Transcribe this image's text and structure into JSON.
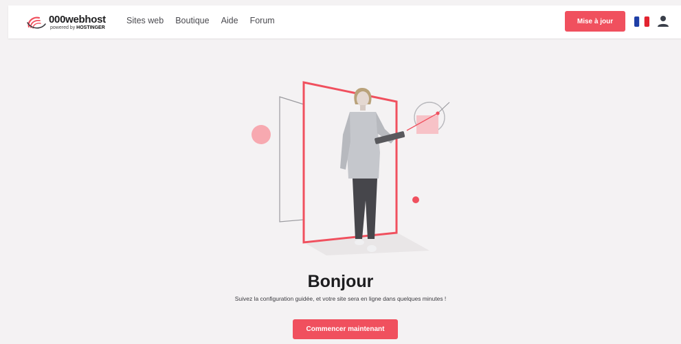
{
  "brand": {
    "name": "000webhost",
    "powered_prefix": "powered by",
    "powered_brand": "HOSTINGER"
  },
  "nav": {
    "items": [
      "Sites web",
      "Boutique",
      "Aide",
      "Forum"
    ]
  },
  "header": {
    "upgrade_label": "Mise à jour",
    "flag_icon": "france-flag-icon",
    "user_icon": "user-icon"
  },
  "hero": {
    "title": "Bonjour",
    "subtitle": "Suivez la configuration guidée, et votre site sera en ligne dans quelques minutes !",
    "cta_label": "Commencer maintenant"
  },
  "colors": {
    "accent": "#f0505e",
    "background": "#f4f2f3",
    "header": "#ffffff",
    "text": "#1d1d1f"
  }
}
